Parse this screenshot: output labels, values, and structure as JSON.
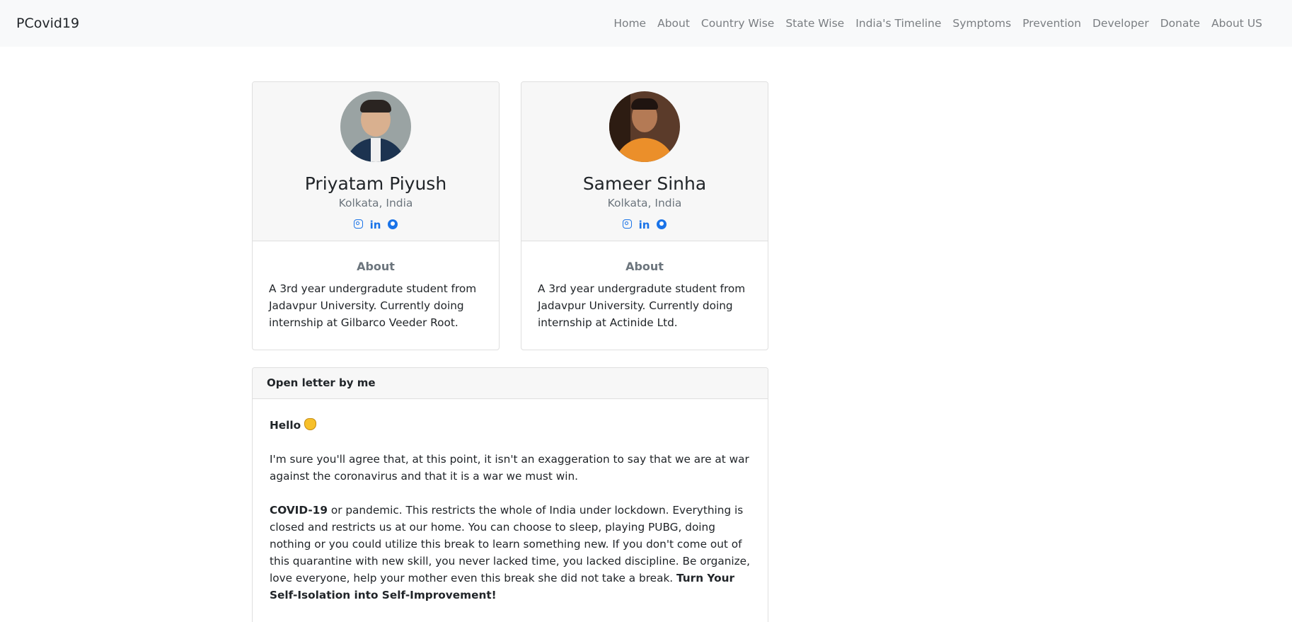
{
  "nav": {
    "brand": "PCovid19",
    "items": [
      "Home",
      "About",
      "Country Wise",
      "State Wise",
      "India's Timeline",
      "Symptoms",
      "Prevention",
      "Developer",
      "Donate",
      "About US"
    ]
  },
  "profiles": [
    {
      "name": "Priyatam Piyush",
      "location": "Kolkata, India",
      "socials": [
        "instagram-icon",
        "linkedin-icon",
        "github-icon"
      ],
      "about_heading": "About",
      "about_text": "A 3rd year undergradute student from Jadavpur University. Currently doing internship at Gilbarco Veeder Root."
    },
    {
      "name": "Sameer Sinha",
      "location": "Kolkata, India",
      "socials": [
        "instagram-icon",
        "linkedin-icon",
        "github-icon"
      ],
      "about_heading": "About",
      "about_text": "A 3rd year undergradute student from Jadavpur University. Currently doing internship at Actinide Ltd."
    }
  ],
  "letter": {
    "header": "Open letter by me",
    "greeting": "Hello",
    "greeting_icon": "waving-hand-icon",
    "para1": "I'm sure you'll agree that, at this point, it isn't an exaggeration to say that we are at war against the coronavirus and that it is a war we must win.",
    "para2_bold": "COVID-19",
    "para2_text": " or pandemic. This restricts the whole of India under lockdown. Everything is closed and restricts us at our home. You can choose to sleep, playing PUBG, doing nothing or you could utilize this break to learn something new. If you don't come out of this quarantine with new skill, you never lacked time, you lacked discipline. Be organize, love everyone, help your mother even this break she did not take a break. ",
    "para2_tail_bold": "Turn Your Self-Isolation into Self-Improvement!"
  },
  "colors": {
    "accent": "#1a73e8",
    "muted": "#6c757d",
    "nav_bg": "#f8f9fa"
  }
}
